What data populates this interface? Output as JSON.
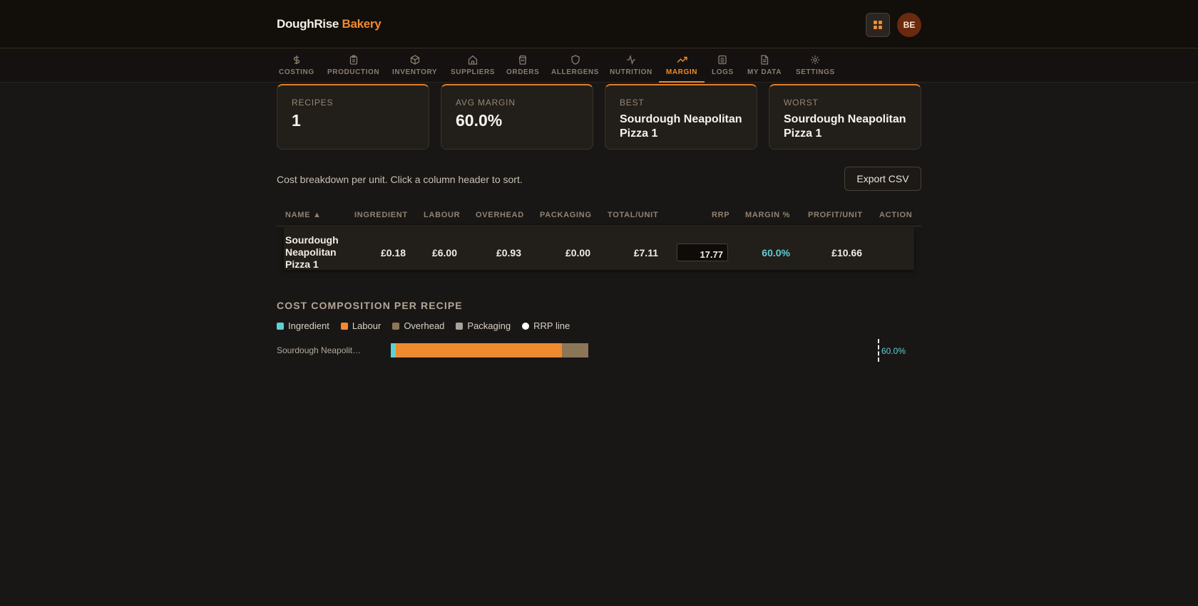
{
  "header": {
    "brand_main": "DoughRise",
    "brand_accent": "Bakery",
    "avatar_initials": "BE"
  },
  "nav": {
    "items": [
      {
        "label": "COSTING",
        "icon": "dollar-icon"
      },
      {
        "label": "PRODUCTION",
        "icon": "clipboard-icon"
      },
      {
        "label": "INVENTORY",
        "icon": "box-icon"
      },
      {
        "label": "SUPPLIERS",
        "icon": "home-icon"
      },
      {
        "label": "ORDERS",
        "icon": "bag-icon"
      },
      {
        "label": "ALLERGENS",
        "icon": "shield-icon"
      },
      {
        "label": "NUTRITION",
        "icon": "pulse-icon"
      },
      {
        "label": "MARGIN",
        "icon": "trend-up-icon",
        "active": true
      },
      {
        "label": "LOGS",
        "icon": "list-icon"
      },
      {
        "label": "MY DATA",
        "icon": "document-icon"
      },
      {
        "label": "SETTINGS",
        "icon": "gear-icon"
      }
    ]
  },
  "stats": {
    "recipes": {
      "label": "RECIPES",
      "value": "1"
    },
    "avg_margin": {
      "label": "AVG MARGIN",
      "value": "60.0%"
    },
    "best": {
      "label": "BEST",
      "value": "Sourdough Neapolitan Pizza 1"
    },
    "worst": {
      "label": "WORST",
      "value": "Sourdough Neapolitan Pizza 1"
    }
  },
  "table": {
    "description": "Cost breakdown per unit. Click a column header to sort.",
    "export_label": "Export CSV",
    "headers": [
      "NAME ▲",
      "INGREDIENT",
      "LABOUR",
      "OVERHEAD",
      "PACKAGING",
      "TOTAL/UNIT",
      "RRP",
      "MARGIN %",
      "PROFIT/UNIT",
      "ACTION"
    ],
    "rows": [
      {
        "name": "Sourdough Neapolitan Pizza 1",
        "ingredient": "£0.18",
        "labour": "£6.00",
        "overhead": "£0.93",
        "packaging": "£0.00",
        "total": "£7.11",
        "rrp": "17.77",
        "margin": "60.0%",
        "profit": "£10.66"
      }
    ]
  },
  "composition": {
    "title": "COST COMPOSITION PER RECIPE",
    "legend": [
      {
        "label": "Ingredient",
        "color": "#5fd0d2"
      },
      {
        "label": "Labour",
        "color": "#f08a30"
      },
      {
        "label": "Overhead",
        "color": "#8c7658"
      },
      {
        "label": "Packaging",
        "color": "#a8a29a"
      },
      {
        "label": "RRP line",
        "color": "#ffffff"
      }
    ],
    "bar_label": "Sourdough Neapolit…",
    "rrp_margin_label": "60.0%"
  },
  "chart_data": {
    "type": "bar",
    "categories": [
      "Sourdough Neapolitan Pizza 1"
    ],
    "series": [
      {
        "name": "Ingredient",
        "values": [
          0.18
        ]
      },
      {
        "name": "Labour",
        "values": [
          6.0
        ]
      },
      {
        "name": "Overhead",
        "values": [
          0.93
        ]
      },
      {
        "name": "Packaging",
        "values": [
          0.0
        ]
      }
    ],
    "rrp": [
      17.77
    ],
    "margin_pct": [
      60.0
    ]
  }
}
